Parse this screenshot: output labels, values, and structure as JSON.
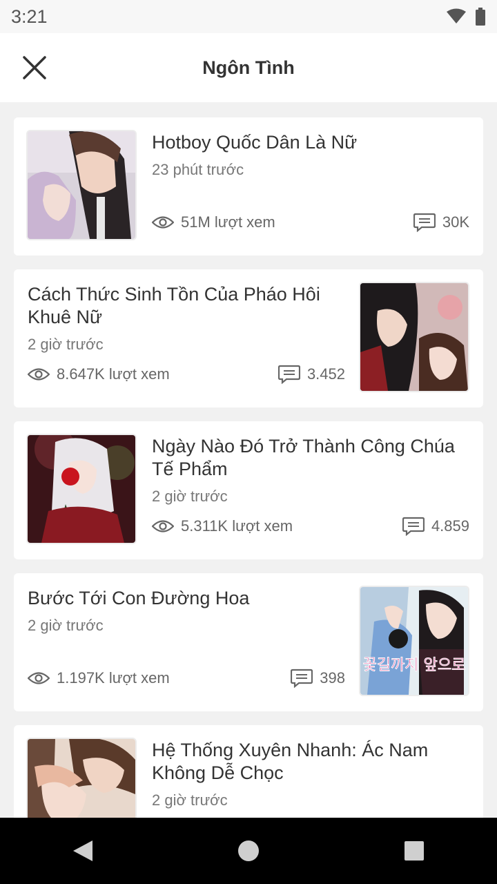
{
  "status": {
    "time": "3:21"
  },
  "header": {
    "title": "Ngôn Tình"
  },
  "stories": [
    {
      "title": "Hotboy Quốc Dân Là Nữ",
      "time": "23 phút trước",
      "views": "51M lượt xem",
      "comments": "30K",
      "thumb_side": "left"
    },
    {
      "title": "Cách Thức Sinh Tồn Của Pháo Hôi Khuê Nữ",
      "time": "2 giờ trước",
      "views": "8.647K lượt xem",
      "comments": "3.452",
      "thumb_side": "right"
    },
    {
      "title": "Ngày Nào Đó Trở Thành Công Chúa Tế Phẩm",
      "time": "2 giờ trước",
      "views": "5.311K lượt xem",
      "comments": "4.859",
      "thumb_side": "left"
    },
    {
      "title": "Bước Tới Con Đường Hoa",
      "time": "2 giờ trước",
      "views": "1.197K lượt xem",
      "comments": "398",
      "thumb_side": "right",
      "cover_text": "꽃길까지 앞으로"
    },
    {
      "title": "Hệ Thống Xuyên Nhanh: Ác Nam Không Dễ Chọc",
      "time": "2 giờ trước",
      "thumb_side": "left"
    }
  ],
  "icons": {
    "close": "close-icon",
    "views": "eye-icon",
    "comments": "comment-icon",
    "back": "back-icon",
    "home": "home-icon",
    "recents": "recents-icon"
  }
}
